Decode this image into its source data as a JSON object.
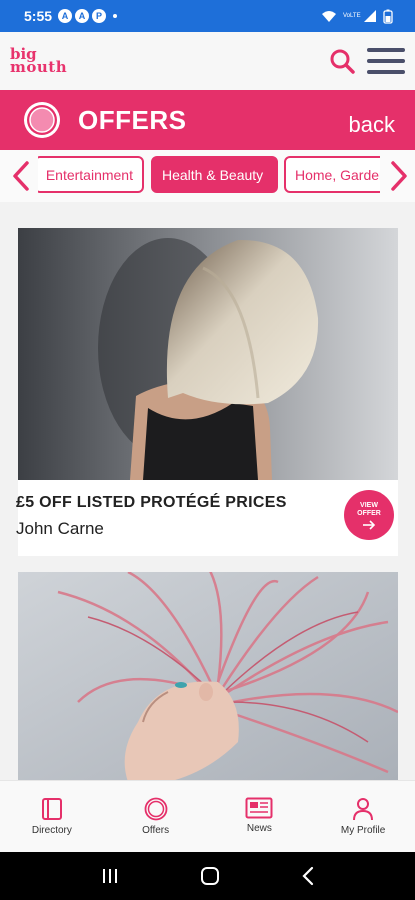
{
  "status_bar": {
    "time": "5:55",
    "left_icons": [
      "A",
      "A",
      "P"
    ],
    "signal_label": "VoLTE"
  },
  "app": {
    "logo_line1": "big",
    "logo_line2": "mouth"
  },
  "banner": {
    "title": "OFFERS",
    "back_label": "back"
  },
  "categories": {
    "items": [
      "Entertainment",
      "Health & Beauty",
      "Home, Garden"
    ],
    "selected": "Health & Beauty"
  },
  "offers": [
    {
      "title": "£5 OFF LISTED PROTÉGÉ PRICES",
      "merchant": "John Carne",
      "button_label": "VIEW OFFER"
    }
  ],
  "bottom_nav": {
    "items": [
      {
        "label": "Directory",
        "icon": "book-icon"
      },
      {
        "label": "Offers",
        "icon": "offers-circle-icon"
      },
      {
        "label": "News",
        "icon": "newspaper-icon"
      },
      {
        "label": "My Profile",
        "icon": "person-icon"
      }
    ]
  },
  "colors": {
    "brand": "#e5306a",
    "status_bar": "#1e6fd9",
    "nav_icon": "#e5306a",
    "menu_icon": "#4a4f6a"
  }
}
